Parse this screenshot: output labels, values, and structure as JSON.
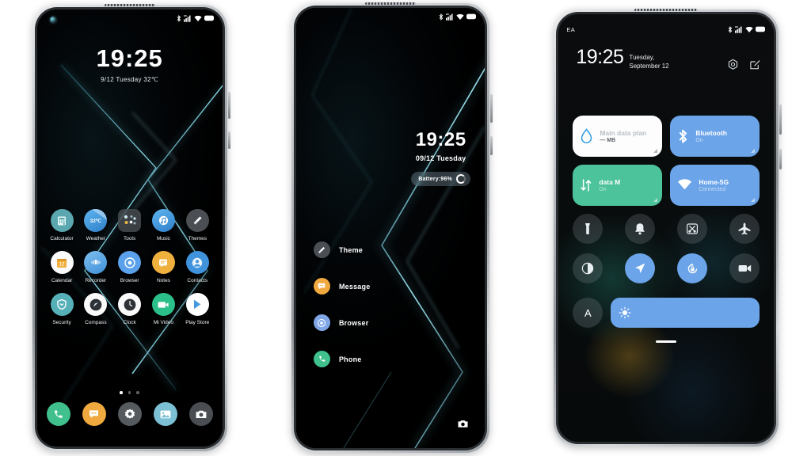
{
  "phone1": {
    "name": "home-screen-phone",
    "status": {
      "icons": [
        "bluetooth-icon",
        "signal-icon",
        "wifi-icon",
        "battery-icon"
      ]
    },
    "clock": {
      "time": "19:25",
      "date": "9/12 Tuesday  32℃"
    },
    "apps": [
      [
        {
          "label": "Calculator",
          "icon": "calculator-icon",
          "color": "#5ba7b0"
        },
        {
          "label": "Weather",
          "icon": "weather-icon",
          "color": "#3f8fd8",
          "badge": "32℃"
        },
        {
          "label": "Tools",
          "icon": "tools-folder-icon",
          "color": "#3c4146"
        },
        {
          "label": "Music",
          "icon": "music-icon",
          "color": "#3f8fd8"
        },
        {
          "label": "Themes",
          "icon": "themes-brush-icon",
          "color": "#4b4f54"
        }
      ],
      [
        {
          "label": "Calendar",
          "icon": "calendar-icon",
          "color": "#f7f7f7",
          "badge": "12"
        },
        {
          "label": "Recorder",
          "icon": "recorder-icon",
          "color": "#62a9df"
        },
        {
          "label": "Browser",
          "icon": "browser-icon",
          "color": "#5aa0ea"
        },
        {
          "label": "Notes",
          "icon": "notes-icon",
          "color": "#f0b03e"
        },
        {
          "label": "Contacts",
          "icon": "contacts-icon",
          "color": "#3f93dd"
        }
      ],
      [
        {
          "label": "Security",
          "icon": "security-shield-icon",
          "color": "#56b0b8"
        },
        {
          "label": "Compass",
          "icon": "compass-icon",
          "color": "#f7f7f7"
        },
        {
          "label": "Clock",
          "icon": "clock-icon",
          "color": "#f7f7f7"
        },
        {
          "label": "Mi Video",
          "icon": "mi-video-icon",
          "color": "#2bc089"
        },
        {
          "label": "Play Store",
          "icon": "play-store-icon",
          "color": "#ffffff"
        }
      ]
    ],
    "page_dots": {
      "count": 3,
      "active": 1
    },
    "dock": [
      {
        "name": "phone-dock-icon",
        "color": "#3fc08d"
      },
      {
        "name": "messages-dock-icon",
        "color": "#f0a93e"
      },
      {
        "name": "settings-dock-icon",
        "color": "#555a5f"
      },
      {
        "name": "gallery-dock-icon",
        "color": "#7bc0d4"
      },
      {
        "name": "camera-dock-icon",
        "color": "#4a4e53"
      }
    ]
  },
  "phone2": {
    "name": "lock-screen-phone",
    "clock": {
      "time": "19:25",
      "date": "09/12 Tuesday",
      "battery": "Battery:96%"
    },
    "shortcuts": [
      {
        "label": "Theme",
        "icon": "themes-brush-icon",
        "color": "#4b4f54"
      },
      {
        "label": "Message",
        "icon": "messages-icon",
        "color": "#f0a93e"
      },
      {
        "label": "Browser",
        "icon": "browser-icon",
        "color": "#7fa7e8"
      },
      {
        "label": "Phone",
        "icon": "phone-icon",
        "color": "#3fc08d"
      }
    ],
    "camera_shortcut": "camera-shortcut-icon"
  },
  "phone3": {
    "name": "control-center-phone",
    "carrier": "EA",
    "header": {
      "time": "19:25",
      "date": "Tuesday, September 12"
    },
    "header_actions": [
      {
        "name": "settings-gear-icon"
      },
      {
        "name": "edit-icon"
      }
    ],
    "tiles": [
      {
        "name": "data-plan-tile",
        "title": "Main data plan",
        "sub": "— MB",
        "style": "white",
        "icon": "water-drop-icon"
      },
      {
        "name": "bluetooth-tile",
        "title": "Bluetooth",
        "sub": "On",
        "style": "blue",
        "icon": "bluetooth-icon"
      },
      {
        "name": "mobile-data-tile",
        "title": "data    M",
        "sub": "On",
        "style": "green",
        "icon": "data-arrows-icon"
      },
      {
        "name": "wifi-tile",
        "title": "Home-5G",
        "sub": "Connected",
        "style": "blue",
        "icon": "wifi-icon"
      }
    ],
    "toggles": [
      [
        {
          "name": "flashlight-toggle",
          "icon": "flashlight-icon",
          "on": false
        },
        {
          "name": "ringer-toggle",
          "icon": "bell-icon",
          "on": false
        },
        {
          "name": "screenshot-toggle",
          "icon": "screenshot-icon",
          "on": false
        },
        {
          "name": "airplane-toggle",
          "icon": "airplane-icon",
          "on": false
        }
      ],
      [
        {
          "name": "dark-mode-toggle",
          "icon": "contrast-icon",
          "on": false
        },
        {
          "name": "location-toggle",
          "icon": "location-arrow-icon",
          "on": true
        },
        {
          "name": "rotation-lock-toggle",
          "icon": "rotation-lock-icon",
          "on": true
        },
        {
          "name": "screen-record-toggle",
          "icon": "video-camera-icon",
          "on": false
        }
      ]
    ],
    "auto_brightness": "A",
    "brightness_icon": "sun-icon"
  }
}
